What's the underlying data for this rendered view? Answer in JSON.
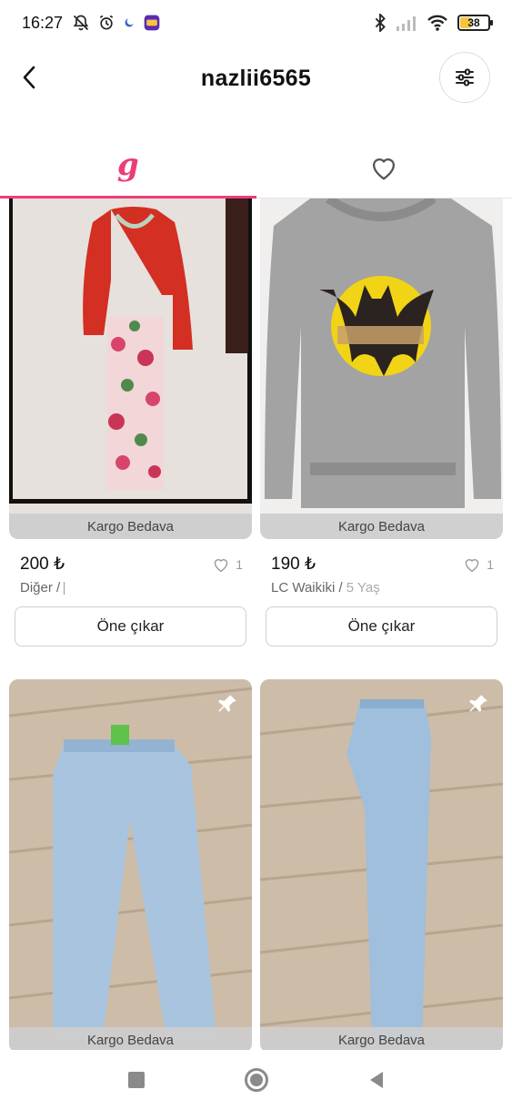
{
  "status_bar": {
    "time": "16:27",
    "battery": "38",
    "battery_level": 0.38
  },
  "header": {
    "title": "nazlii6565",
    "back_icon": "chevron-left-icon",
    "filter_icon": "sliders-icon"
  },
  "tabs": [
    {
      "glyph": "g",
      "icon": "gardrops-logo-icon",
      "active": true
    },
    {
      "icon": "heart-outline-icon",
      "active": false
    }
  ],
  "products": [
    {
      "badge": "Kargo Bedava",
      "price": "200 ₺",
      "likes": "1",
      "brand": "Diğer / ",
      "size": "",
      "promote_label": "Öne çıkar"
    },
    {
      "badge": "Kargo Bedava",
      "price": "190 ₺",
      "likes": "1",
      "brand": "LC Waikiki / ",
      "size": "5 Yaş",
      "promote_label": "Öne çıkar"
    },
    {
      "badge": "Kargo Bedava",
      "pinned": true
    },
    {
      "badge": "Kargo Bedava",
      "pinned": true
    }
  ],
  "colors": {
    "accent": "#ec3d7a",
    "badge_bg": "#cdcdcd"
  }
}
